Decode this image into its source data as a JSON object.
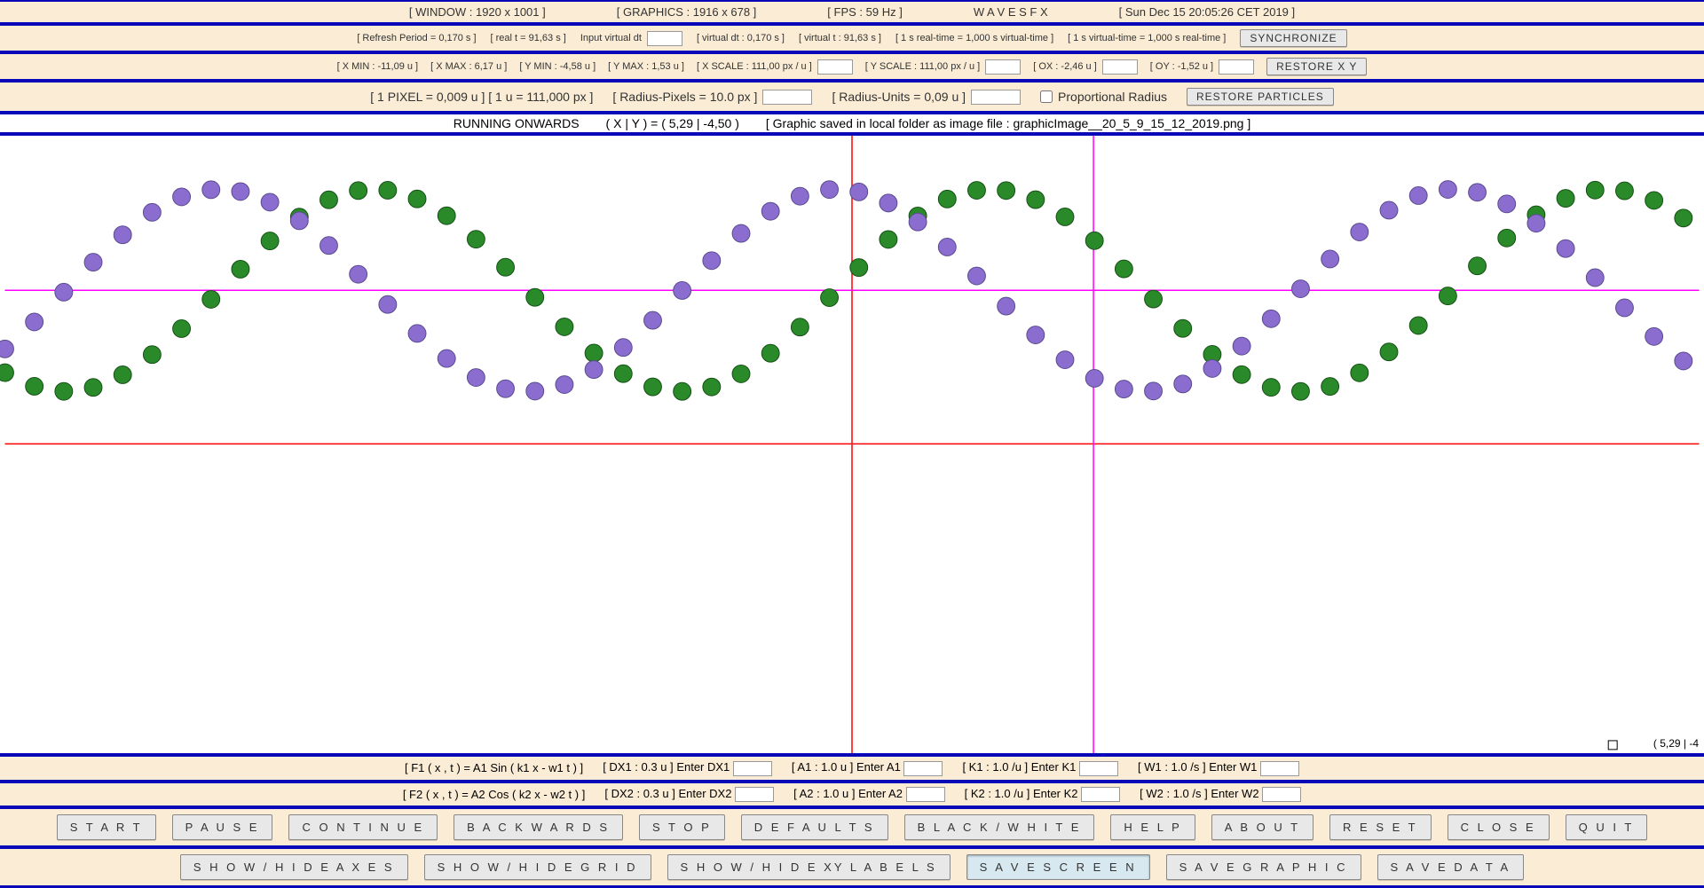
{
  "topbar": {
    "window": "[ WINDOW : 1920 x 1001 ]",
    "graphics": "[ GRAPHICS : 1916 x 678 ]",
    "fps": "[ FPS : 59 Hz ]",
    "title": "W   A   V   E   S        F X",
    "date": "[ Sun Dec 15 20:05:26 CET 2019 ]"
  },
  "timebar": {
    "refresh": "[ Refresh Period = 0,170 s ]",
    "realt": "[ real t = 91,63 s ]",
    "input_vdt": "Input virtual dt",
    "vdt": "[ virtual dt : 0,170 s ]",
    "vt": "[ virtual t : 91,63 s ]",
    "rt_vt": "[ 1 s real-time = 1,000 s virtual-time ]",
    "vt_rt": "[ 1 s virtual-time = 1,000 s real-time ]",
    "sync": "SYNCHRONIZE"
  },
  "axesbar": {
    "xmin": "[ X MIN : -11,09 u ]",
    "xmax": "[ X MAX : 6,17 u ]",
    "ymin": "[ Y MIN : -4,58 u ]",
    "ymax": "[ Y MAX : 1,53 u ]",
    "xscale": "[ X SCALE : 111,00 px / u ]",
    "yscale": "[ Y SCALE : 111,00 px / u ]",
    "ox": "[ OX :   -2,46 u ]",
    "oy": "[ OY :   -1,52 u ]",
    "restore": "RESTORE  X Y"
  },
  "radiusbar": {
    "pixel_u": "[ 1 PIXEL = 0,009 u ] [ 1 u = 111,000 px ]",
    "rad_px": "[ Radius-Pixels = 10.0 px ]",
    "rad_u": "[ Radius-Units = 0,09 u ]",
    "prop": "Proportional Radius",
    "restore": "RESTORE  PARTICLES"
  },
  "status": {
    "running": "RUNNING ONWARDS",
    "xy": "( X | Y )  =  ( 5,29 | -4,50 )",
    "saved": "[ Graphic saved in local folder as image file : graphicImage__20_5_9_15_12_2019.png ]"
  },
  "params": {
    "f1": "[ F1 ( x , t ) = A1 Sin ( k1 x - w1 t ) ]",
    "dx1": "[ DX1 : 0.3 u ]",
    "dx1l": "Enter DX1",
    "a1": "[ A1 : 1.0 u ]",
    "a1l": "Enter A1",
    "k1": "[ K1 : 1.0 /u ]",
    "k1l": "Enter K1",
    "w1": "[ W1 : 1.0 /s ]",
    "w1l": "Enter W1",
    "f2": "[ F2 ( x , t ) = A2 Cos ( k2 x - w2 t ) ]",
    "dx2": "[ DX2 : 0.3 u ]",
    "dx2l": "Enter DX2",
    "a2": "[ A2 : 1.0 u ]",
    "a2l": "Enter A2",
    "k2": "[ K2 : 1.0 /u ]",
    "k2l": "Enter K2",
    "w2": "[ W2 : 1.0 /s ]",
    "w2l": "Enter W2"
  },
  "buttons1": [
    "S T A R T",
    "P A U S E",
    "C O N T I N U E",
    "B A C K W A R D S",
    "S T O P",
    "D E F A U L T S",
    "B L A C K / W H I T E",
    "H E L P",
    "A B O U T",
    "R E S E T",
    "C L O S E",
    "Q U I T"
  ],
  "buttons2": [
    "S H O W / H I D E   A X E S",
    "S H O W / H I D E   G R I D",
    "S H O W / H I D E   XY  L A B E L S",
    "S A V E   S C R E E N",
    "S A V E   G R A P H I C",
    "S A V E   D A T A"
  ],
  "mouse_corner": "(  5,29  |  -4",
  "chart_data": {
    "type": "scatter",
    "title": "WAVES FX",
    "xlim": [
      -11.09,
      6.17
    ],
    "ylim": [
      -4.58,
      1.53
    ],
    "origin": {
      "ox": -2.46,
      "oy": -1.52
    },
    "dx": 0.3,
    "t": 91.63,
    "guides": {
      "red_vertical_x": -2.46,
      "red_horizontal_y": -1.52,
      "magenta_vertical_x": 0.0,
      "magenta_horizontal_y": 0.0
    },
    "series": [
      {
        "name": "F1 = A1·sin(k1·x − w1·t)",
        "color": "#2a8a2a",
        "radius_px": 10,
        "params": {
          "A1": 1.0,
          "k1": 1.0,
          "w1": 1.0,
          "dx": 0.3
        }
      },
      {
        "name": "F2 = A2·cos(k2·x − w2·t)",
        "color": "#8b6dcf",
        "radius_px": 10,
        "params": {
          "A2": 1.0,
          "k2": 1.0,
          "w2": 1.0,
          "dx": 0.3
        }
      }
    ],
    "marker": {
      "mouse_xy": [
        5.29,
        -4.5
      ]
    }
  }
}
